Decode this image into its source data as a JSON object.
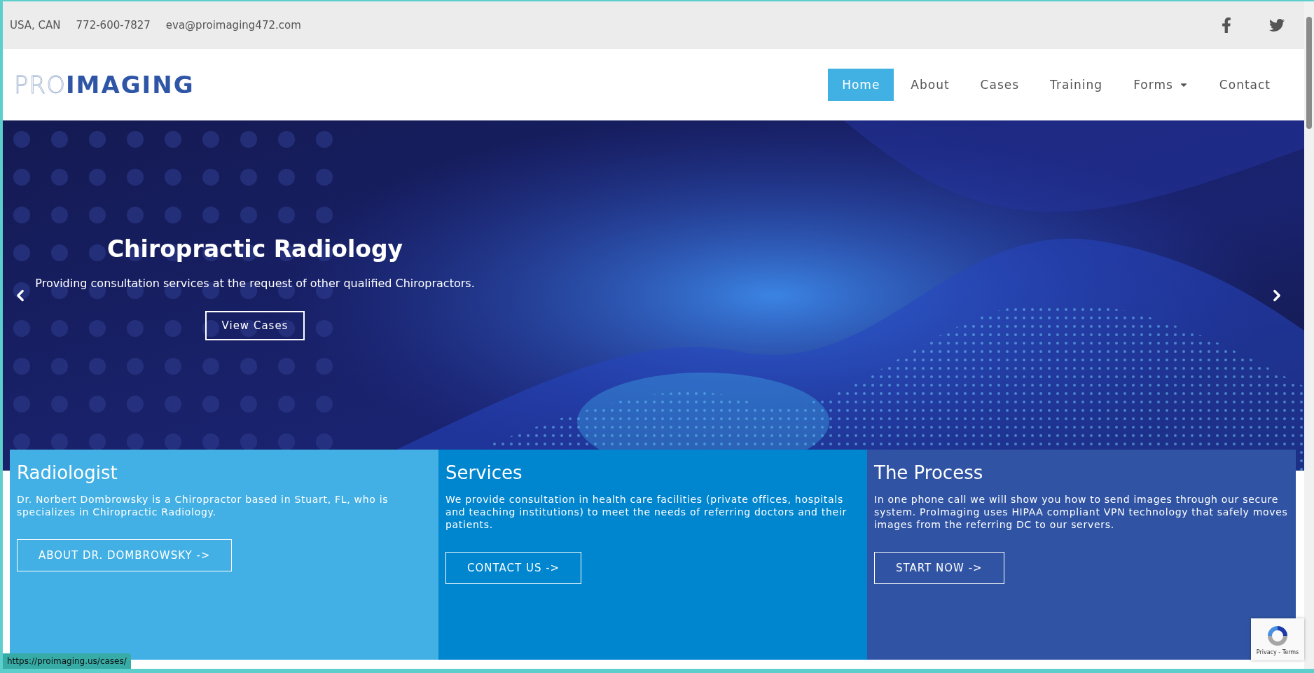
{
  "top_bar": {
    "location": "USA, CAN",
    "phone": "772-600-7827",
    "email": "eva@proimaging472.com"
  },
  "logo": {
    "light": "PRO",
    "bold": "IMAGING"
  },
  "nav": [
    {
      "label": "Home",
      "selected": true,
      "dropdown": false
    },
    {
      "label": "About",
      "selected": false,
      "dropdown": false
    },
    {
      "label": "Cases",
      "selected": false,
      "dropdown": false
    },
    {
      "label": "Training",
      "selected": false,
      "dropdown": false
    },
    {
      "label": "Forms",
      "selected": false,
      "dropdown": true
    },
    {
      "label": "Contact",
      "selected": false,
      "dropdown": false
    }
  ],
  "hero": {
    "title": "Chiropractic Radiology",
    "subtitle": "Providing consultation services at the request of other qualified Chiropractors.",
    "button": "View Cases"
  },
  "panels": [
    {
      "title": "Radiologist",
      "text": "Dr. Norbert Dombrowsky is a Chiropractor based in Stuart, FL, who is specializes in Chiropractic Radiology.",
      "button": "ABOUT DR. DOMBROWSKY ->",
      "color": "#42b0e4"
    },
    {
      "title": "Services",
      "text": "We provide consultation in health care facilities (private offices, hospitals and teaching institutions) to meet the needs of referring doctors and their patients.",
      "button": "CONTACT US ->",
      "color": "#0085cf"
    },
    {
      "title": "The Process",
      "text": "In one phone call we will show you how to send images through our secure system. ProImaging uses HIPAA compliant VPN technology that safely moves images from the referring DC to our servers.",
      "button": "START NOW ->",
      "color": "#3054a3"
    }
  ],
  "status_url": "https://proimaging.us/cases/",
  "recaptcha": {
    "links": "Privacy - Terms"
  }
}
